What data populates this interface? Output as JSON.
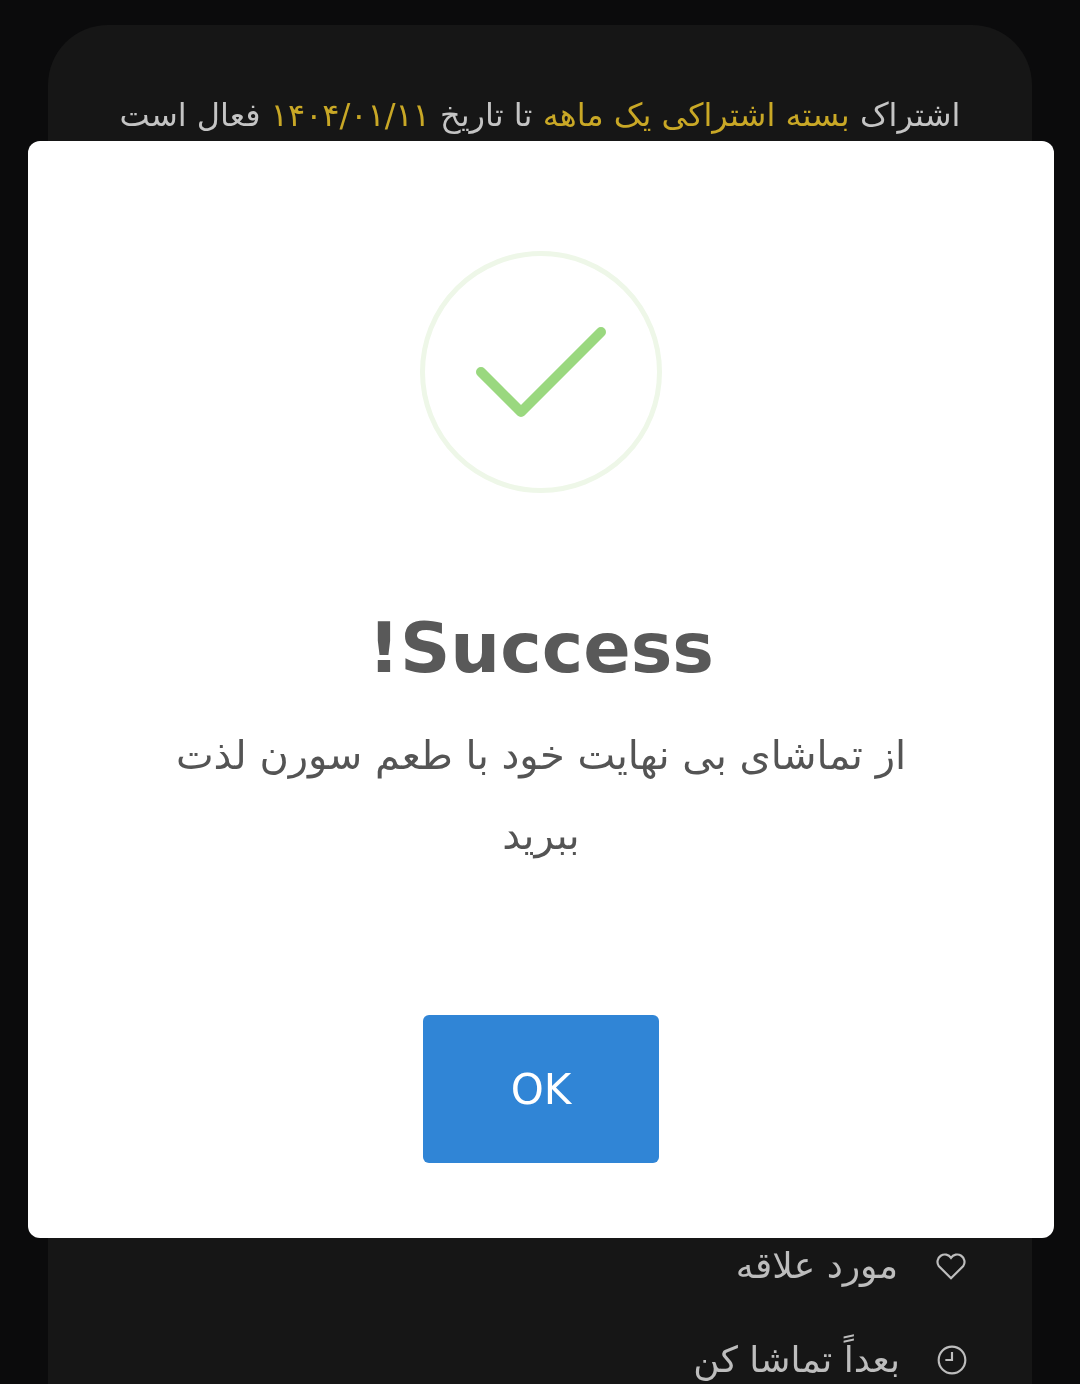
{
  "subscription_notice": [
    {
      "text": "اشتراک",
      "highlight": false
    },
    {
      "text": "بسته اشتراکی یک ماهه",
      "highlight": true
    },
    {
      "text": "تا تاریخ",
      "highlight": false
    },
    {
      "text": "۱۴۰۴/۰۱/۱۱",
      "highlight": true
    },
    {
      "text": "فعال است",
      "highlight": false
    }
  ],
  "menu": [
    {
      "label": "مورد علاقه",
      "kind": "heart"
    },
    {
      "label": "بعداً تماشا کن",
      "kind": "clock"
    }
  ],
  "dialog": {
    "title": "Success!",
    "message": "از تماشای بی نهایت خود با طعم سورن لذت ببرید",
    "button": "OK"
  }
}
